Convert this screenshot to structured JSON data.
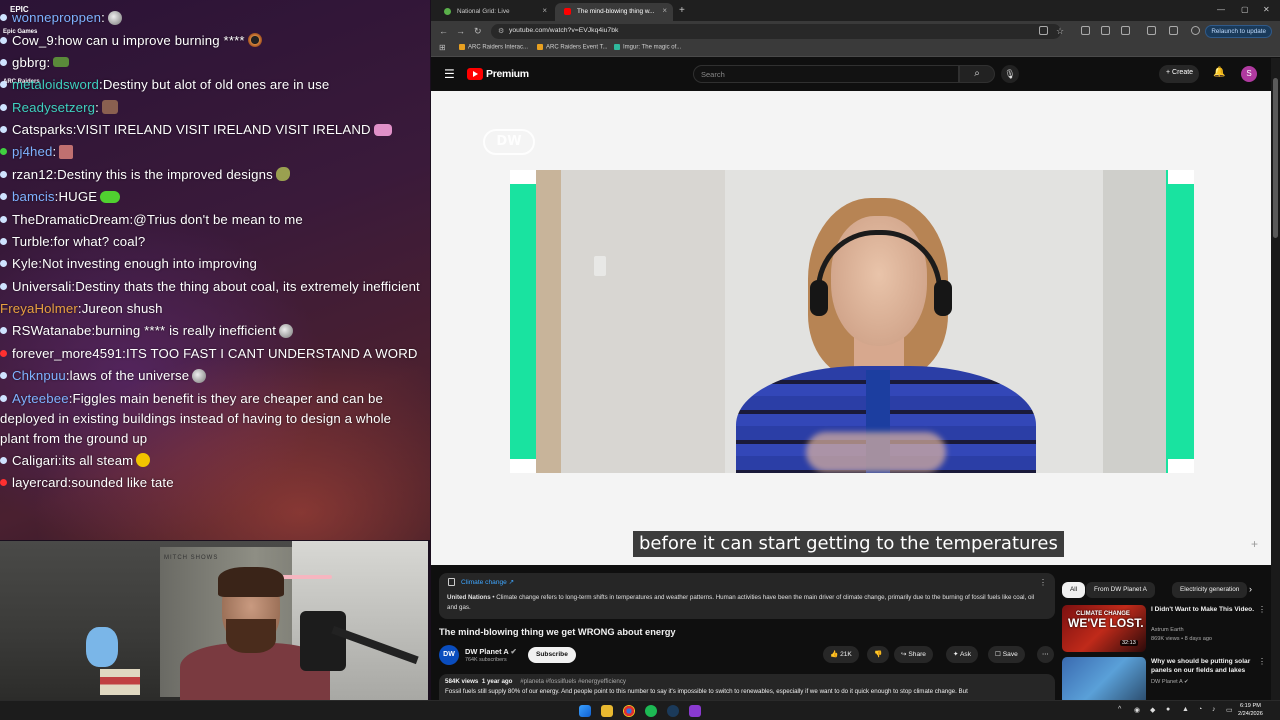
{
  "chat": {
    "epic_label": "EPIC\nGames",
    "epic_sublabel": "Epic Games",
    "arc_sublabel": "ARC Raiders",
    "messages": [
      {
        "user": "wonneproppen",
        "text": "",
        "color": "blue",
        "dot": "blue",
        "emote": "gray"
      },
      {
        "user": "Cow_9",
        "text": "how can u improve burning ****",
        "color": "white",
        "dot": "blue",
        "emote": "ring"
      },
      {
        "user": "gbbrg",
        "text": "",
        "color": "white",
        "dot": "blue",
        "emote": "green"
      },
      {
        "user": "metaloidsword",
        "text": "Destiny but alot of old ones are in use",
        "color": "teal",
        "dot": "blue",
        "emote": ""
      },
      {
        "user": "Readysetzerg",
        "text": "",
        "color": "teal",
        "dot": "blue",
        "emote": "brown"
      },
      {
        "user": "Catsparks",
        "text": "VISIT IRELAND   VISIT IRELAND   VISIT IRELAND",
        "color": "white",
        "dot": "blue",
        "emote": "pink"
      },
      {
        "user": "pj4hed",
        "text": "",
        "color": "blue",
        "dot": "green",
        "emote": "rose"
      },
      {
        "user": "rzan12",
        "text": "Destiny this is the improved designs",
        "color": "white",
        "dot": "blue",
        "emote": "olive"
      },
      {
        "user": "bamcis",
        "text": "HUGE",
        "color": "blue",
        "dot": "blue",
        "emote": "lime"
      },
      {
        "user": "TheDramaticDream",
        "text": "@Trius don't be mean to me",
        "color": "white",
        "dot": "blue",
        "emote": ""
      },
      {
        "user": "Turble",
        "text": "for what? coal?",
        "color": "white",
        "dot": "blue",
        "emote": ""
      },
      {
        "user": "Kyle",
        "text": "Not investing enough into improving",
        "color": "white",
        "dot": "blue",
        "emote": ""
      },
      {
        "user": "Universali",
        "text": "Destiny thats the thing about coal, its extremely inefficient",
        "color": "white",
        "dot": "blue",
        "emote": ""
      },
      {
        "user": "FreyaHolmer",
        "text": "Jureon shush",
        "color": "orange",
        "dot": "none",
        "emote": ""
      },
      {
        "user": "RSWatanabe",
        "text": "burning **** is really inefficient",
        "color": "white",
        "dot": "blue",
        "emote": "gray"
      },
      {
        "user": "forever_more4591",
        "text": "ITS TOO FAST I CANT UNDERSTAND A WORD",
        "color": "white",
        "dot": "red",
        "emote": ""
      },
      {
        "user": "Chknpuu",
        "text": "laws of the universe",
        "color": "blue",
        "dot": "blue",
        "emote": "gray"
      },
      {
        "user": "Ayteebee",
        "text": "Figgles main benefit is they are cheaper and can be deployed in existing buildings instead of having to design a whole plant from the ground up",
        "color": "blue",
        "dot": "blue",
        "emote": ""
      },
      {
        "user": "Caligari",
        "text": "its all steam",
        "color": "white",
        "dot": "blue",
        "emote": "yellow"
      },
      {
        "user": "layercard",
        "text": "sounded like tate",
        "color": "white",
        "dot": "red",
        "emote": ""
      }
    ]
  },
  "webcam": {
    "shelf_text": "MITCH SHOWS"
  },
  "browser": {
    "tabs": [
      {
        "label": "National Grid: Live",
        "active": false
      },
      {
        "label": "The mind-blowing thing w...",
        "active": true
      }
    ],
    "new_tab": "+",
    "url": "youtube.com/watch?v=EVJkq4iu7bk",
    "relaunch_label": "Relaunch to update",
    "bookmarks": [
      "ARC Raiders Interac...",
      "ARC Raiders Event T...",
      "Imgur: The magic of..."
    ]
  },
  "youtube": {
    "logo_word": "Premium",
    "search_placeholder": "Search",
    "create_label": "Create",
    "avatar_letter": "S",
    "watermark": "DW",
    "caption": "before it can start getting to the temperatures",
    "info_panel": {
      "title": "Climate change ↗",
      "source": "United Nations",
      "text": " • Climate change refers to long-term shifts in temperatures and weather patterns. Human activities have been the main driver of climate change, primarily due to the burning of fossil fuels like coal, oil and gas."
    },
    "video_title": "The mind-blowing thing we get WRONG about energy",
    "channel": {
      "avatar": "DW",
      "name": "DW Planet A",
      "subscribers": "764K subscribers",
      "subscribe_label": "Subscribe"
    },
    "actions": {
      "likes": "21K",
      "share": "Share",
      "ask": "Ask",
      "save": "Save"
    },
    "description": {
      "views": "584K views",
      "age": "1 year ago",
      "tags": "#planeta #fossilfuels #energyefficiency",
      "line": "Fossil fuels still supply 80% of our energy. And people point to this number to say it's impossible to switch to renewables, especially if we want to do it quick enough to stop climate change. But"
    },
    "chips": [
      "All",
      "From DW Planet A",
      "Electricity generation"
    ],
    "recommendations": [
      {
        "title": "I Didn't Want to Make This Video.",
        "channel": "Astrum Earth",
        "meta": "869K views • 8 days ago",
        "duration": "32:13",
        "thumb_text": "WE'VE LOST.",
        "thumb_small": "CLIMATE CHANGE"
      },
      {
        "title": "Why we should be putting solar panels on our fields and lakes",
        "channel": "DW Planet A",
        "meta": "",
        "duration": "",
        "thumb_text": "",
        "thumb_small": ""
      }
    ]
  },
  "taskbar": {
    "time": "6:19 PM",
    "date": "2/24/2026"
  }
}
